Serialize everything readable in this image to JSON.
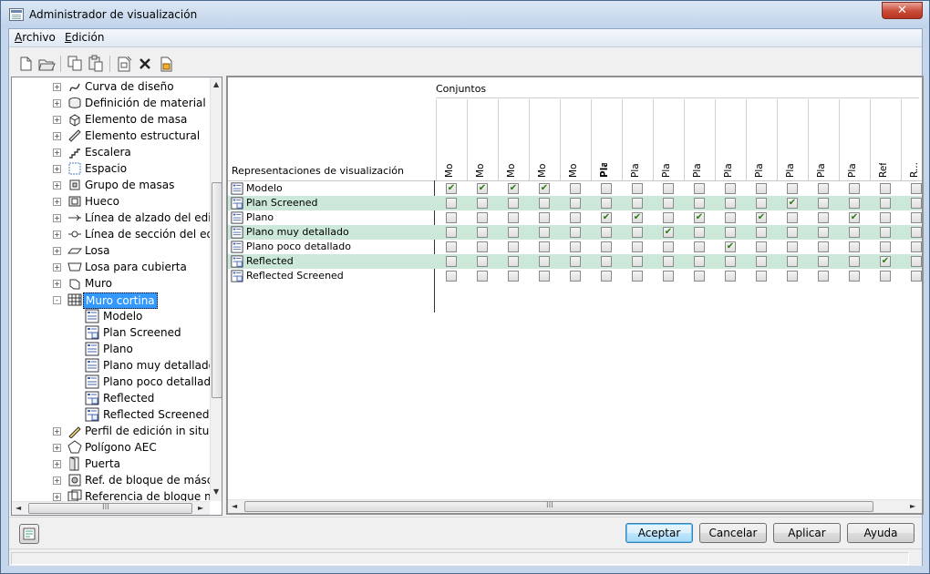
{
  "window": {
    "title": "Administrador de visualización",
    "close_label": "✕"
  },
  "menu": [
    {
      "label": "Archivo",
      "accel": "A"
    },
    {
      "label": "Edición",
      "accel": "E"
    }
  ],
  "toolbar": {
    "buttons": [
      "new-icon",
      "open-icon",
      "copy-icon",
      "paste-icon",
      "properties-icon",
      "delete-icon",
      "purge-icon"
    ]
  },
  "tree": {
    "items": [
      {
        "label": "Curva de diseño",
        "icon": "curve-icon",
        "level": 0,
        "expander": "+"
      },
      {
        "label": "Definición de material",
        "icon": "material-icon",
        "level": 0,
        "expander": "+"
      },
      {
        "label": "Elemento de masa",
        "icon": "mass-element-icon",
        "level": 0,
        "expander": "+"
      },
      {
        "label": "Elemento estructural",
        "icon": "structural-member-icon",
        "level": 0,
        "expander": "+"
      },
      {
        "label": "Escalera",
        "icon": "stair-icon",
        "level": 0,
        "expander": "+"
      },
      {
        "label": "Espacio",
        "icon": "space-icon",
        "level": 0,
        "expander": "+"
      },
      {
        "label": "Grupo de masas",
        "icon": "mass-group-icon",
        "level": 0,
        "expander": "+"
      },
      {
        "label": "Hueco",
        "icon": "opening-icon",
        "level": 0,
        "expander": "+"
      },
      {
        "label": "Línea de alzado del edific",
        "icon": "elevation-line-icon",
        "level": 0,
        "expander": "+"
      },
      {
        "label": "Línea de sección del edifi",
        "icon": "section-line-icon",
        "level": 0,
        "expander": "+"
      },
      {
        "label": "Losa",
        "icon": "slab-icon",
        "level": 0,
        "expander": "+"
      },
      {
        "label": "Losa para cubierta",
        "icon": "roof-slab-icon",
        "level": 0,
        "expander": "+"
      },
      {
        "label": "Muro",
        "icon": "wall-icon",
        "level": 0,
        "expander": "+"
      },
      {
        "label": "Muro cortina",
        "icon": "curtain-wall-icon",
        "level": 0,
        "expander": "-",
        "selected": true
      },
      {
        "label": "Modelo",
        "icon": "display-rep-icon",
        "level": 1
      },
      {
        "label": "Plan Screened",
        "icon": "display-rep-screened-icon",
        "level": 1
      },
      {
        "label": "Plano",
        "icon": "display-rep-icon",
        "level": 1
      },
      {
        "label": "Plano muy detallado",
        "icon": "display-rep-icon",
        "level": 1
      },
      {
        "label": "Plano poco detallado",
        "icon": "display-rep-icon",
        "level": 1
      },
      {
        "label": "Reflected",
        "icon": "display-rep-screened-icon",
        "level": 1
      },
      {
        "label": "Reflected Screened",
        "icon": "display-rep-screened-icon",
        "level": 1
      },
      {
        "label": "Perfil de edición in situ",
        "icon": "in-place-edit-icon",
        "level": 0,
        "expander": "+"
      },
      {
        "label": "Polígono AEC",
        "icon": "polygon-icon",
        "level": 0,
        "expander": "+"
      },
      {
        "label": "Puerta",
        "icon": "door-icon",
        "level": 0,
        "expander": "+"
      },
      {
        "label": "Ref. de bloque de máscar",
        "icon": "mask-block-icon",
        "level": 0,
        "expander": "+"
      },
      {
        "label": "Referencia de bloque mu",
        "icon": "multi-view-block-icon",
        "level": 0,
        "expander": "+"
      }
    ]
  },
  "grid": {
    "group_header": "Conjuntos",
    "rows_header": "Representaciones de visualización",
    "columns": [
      {
        "label": "Model"
      },
      {
        "label": "Model High Det..."
      },
      {
        "label": "Model Low Detail"
      },
      {
        "label": "Model Presenta..."
      },
      {
        "label": "Model Structural"
      },
      {
        "label": "Plan",
        "bold": true
      },
      {
        "label": "Plan Diagnostic"
      },
      {
        "label": "Plan High Detail"
      },
      {
        "label": "Plan Intermedia..."
      },
      {
        "label": "Plan Low Detail"
      },
      {
        "label": "Plan Presentation"
      },
      {
        "label": "Plan Screened"
      },
      {
        "label": "Plan Structural"
      },
      {
        "label": "Plan Top Level"
      },
      {
        "label": "Reflected"
      },
      {
        "label": "R..."
      }
    ],
    "rows": [
      {
        "label": "Modelo",
        "icon": "display-rep-icon",
        "checks": [
          1,
          1,
          1,
          1,
          0,
          0,
          0,
          0,
          0,
          0,
          0,
          0,
          0,
          0,
          0,
          0
        ]
      },
      {
        "label": "Plan Screened",
        "icon": "display-rep-screened-icon",
        "checks": [
          0,
          0,
          0,
          0,
          0,
          0,
          0,
          0,
          0,
          0,
          0,
          1,
          0,
          0,
          0,
          0
        ]
      },
      {
        "label": "Plano",
        "icon": "display-rep-icon",
        "checks": [
          0,
          0,
          0,
          0,
          0,
          1,
          1,
          0,
          1,
          0,
          1,
          0,
          0,
          1,
          0,
          0
        ]
      },
      {
        "label": "Plano muy detallado",
        "icon": "display-rep-icon",
        "checks": [
          0,
          0,
          0,
          0,
          0,
          0,
          0,
          1,
          0,
          0,
          0,
          0,
          0,
          0,
          0,
          0
        ]
      },
      {
        "label": "Plano poco detallado",
        "icon": "display-rep-icon",
        "checks": [
          0,
          0,
          0,
          0,
          0,
          0,
          0,
          0,
          0,
          1,
          0,
          0,
          0,
          0,
          0,
          0
        ]
      },
      {
        "label": "Reflected",
        "icon": "display-rep-screened-icon",
        "checks": [
          0,
          0,
          0,
          0,
          0,
          0,
          0,
          0,
          0,
          0,
          0,
          0,
          0,
          0,
          1,
          0
        ]
      },
      {
        "label": "Reflected Screened",
        "icon": "display-rep-screened-icon",
        "checks": [
          0,
          0,
          0,
          0,
          0,
          0,
          0,
          0,
          0,
          0,
          0,
          0,
          0,
          0,
          0,
          0
        ]
      }
    ]
  },
  "buttons": {
    "ok": "Aceptar",
    "cancel": "Cancelar",
    "apply": "Aplicar",
    "help": "Ayuda"
  },
  "scrollbar": {
    "grip": "III"
  },
  "colors": {
    "selected": "#3399ff",
    "alt_row": "#cce8d8",
    "check": "#2a7a10"
  }
}
